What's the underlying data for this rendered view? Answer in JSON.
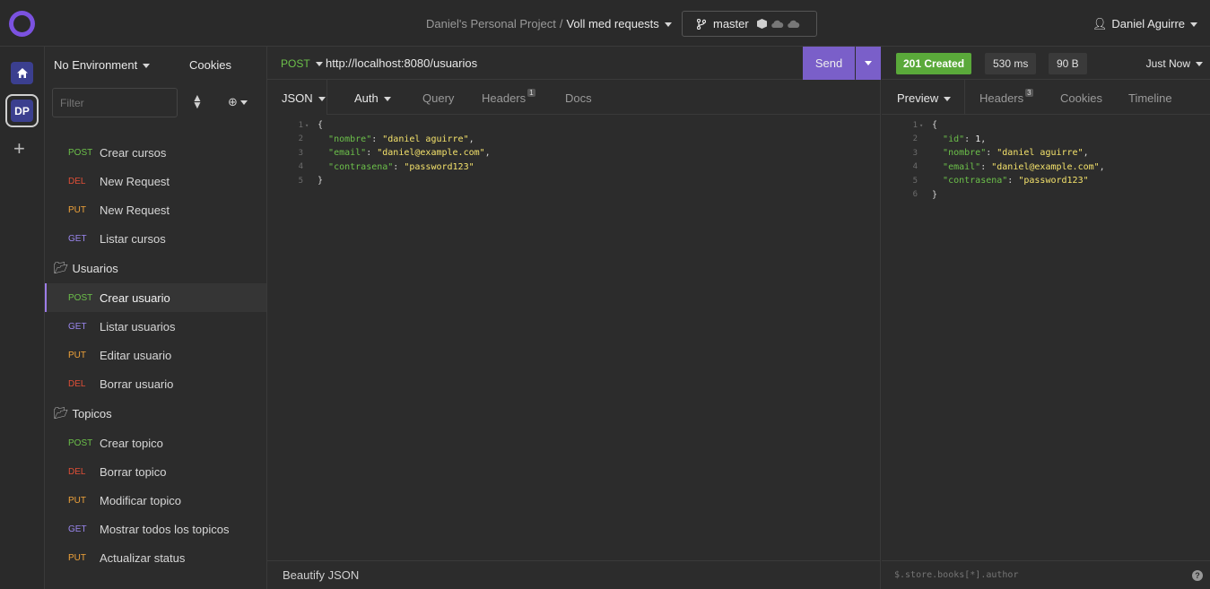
{
  "header": {
    "project": "Daniel's Personal Project",
    "separator": "/",
    "collection": "Voll med requests",
    "branch": "master",
    "user": "Daniel Aguirre"
  },
  "rail": {
    "workspace_initials": "DP",
    "add": "+"
  },
  "sidebar": {
    "environment": "No Environment",
    "cookies": "Cookies",
    "filter_placeholder": "Filter",
    "groups": [
      {
        "folder": "",
        "items": [
          {
            "method": "POST",
            "name": "Crear cursos"
          },
          {
            "method": "DEL",
            "name": "New Request"
          },
          {
            "method": "PUT",
            "name": "New Request"
          },
          {
            "method": "GET",
            "name": "Listar cursos"
          }
        ]
      },
      {
        "folder": "Usuarios",
        "items": [
          {
            "method": "POST",
            "name": "Crear usuario",
            "active": true
          },
          {
            "method": "GET",
            "name": "Listar usuarios"
          },
          {
            "method": "PUT",
            "name": "Editar usuario"
          },
          {
            "method": "DEL",
            "name": "Borrar usuario"
          }
        ]
      },
      {
        "folder": "Topicos",
        "items": [
          {
            "method": "POST",
            "name": "Crear topico"
          },
          {
            "method": "DEL",
            "name": "Borrar topico"
          },
          {
            "method": "PUT",
            "name": "Modificar topico"
          },
          {
            "method": "GET",
            "name": "Mostrar todos los topicos"
          },
          {
            "method": "PUT",
            "name": "Actualizar status"
          }
        ]
      }
    ]
  },
  "request": {
    "method": "POST",
    "url": "http://localhost:8080/usuarios",
    "send": "Send",
    "tabs": {
      "json": "JSON",
      "auth": "Auth",
      "query": "Query",
      "headers": "Headers",
      "headers_count": "1",
      "docs": "Docs"
    },
    "body_lines": [
      {
        "n": "1",
        "fold": true,
        "parts": [
          [
            "p",
            "{"
          ]
        ]
      },
      {
        "n": "2",
        "parts": [
          [
            "p",
            "  "
          ],
          [
            "k",
            "\"nombre\""
          ],
          [
            "p",
            ": "
          ],
          [
            "s",
            "\"daniel aguirre\""
          ],
          [
            "p",
            ","
          ]
        ]
      },
      {
        "n": "3",
        "parts": [
          [
            "p",
            "  "
          ],
          [
            "k",
            "\"email\""
          ],
          [
            "p",
            ": "
          ],
          [
            "s",
            "\"daniel@example.com\""
          ],
          [
            "p",
            ","
          ]
        ]
      },
      {
        "n": "4",
        "parts": [
          [
            "p",
            "  "
          ],
          [
            "k",
            "\"contrasena\""
          ],
          [
            "p",
            ": "
          ],
          [
            "s",
            "\"password123\""
          ]
        ]
      },
      {
        "n": "5",
        "parts": [
          [
            "p",
            "}"
          ]
        ]
      }
    ],
    "footer": "Beautify JSON"
  },
  "response": {
    "status": "201 Created",
    "time": "530 ms",
    "size": "90 B",
    "when": "Just Now",
    "tabs": {
      "preview": "Preview",
      "headers": "Headers",
      "headers_count": "3",
      "cookies": "Cookies",
      "timeline": "Timeline"
    },
    "body_lines": [
      {
        "n": "1",
        "fold": true,
        "parts": [
          [
            "p",
            "{"
          ]
        ]
      },
      {
        "n": "2",
        "parts": [
          [
            "p",
            "  "
          ],
          [
            "k",
            "\"id\""
          ],
          [
            "p",
            ": "
          ],
          [
            "n",
            "1"
          ],
          [
            "p",
            ","
          ]
        ]
      },
      {
        "n": "3",
        "parts": [
          [
            "p",
            "  "
          ],
          [
            "k",
            "\"nombre\""
          ],
          [
            "p",
            ": "
          ],
          [
            "s",
            "\"daniel aguirre\""
          ],
          [
            "p",
            ","
          ]
        ]
      },
      {
        "n": "4",
        "parts": [
          [
            "p",
            "  "
          ],
          [
            "k",
            "\"email\""
          ],
          [
            "p",
            ": "
          ],
          [
            "s",
            "\"daniel@example.com\""
          ],
          [
            "p",
            ","
          ]
        ]
      },
      {
        "n": "5",
        "parts": [
          [
            "p",
            "  "
          ],
          [
            "k",
            "\"contrasena\""
          ],
          [
            "p",
            ": "
          ],
          [
            "s",
            "\"password123\""
          ]
        ]
      },
      {
        "n": "6",
        "parts": [
          [
            "p",
            "}"
          ]
        ]
      }
    ],
    "filter_placeholder": "$.store.books[*].author",
    "help": "?"
  },
  "colors": {
    "accent": "#7a5fc9",
    "post": "#6cc04a",
    "del": "#e04f36",
    "put": "#f0a33a",
    "get": "#9a86ee",
    "created": "#5aa93a"
  }
}
